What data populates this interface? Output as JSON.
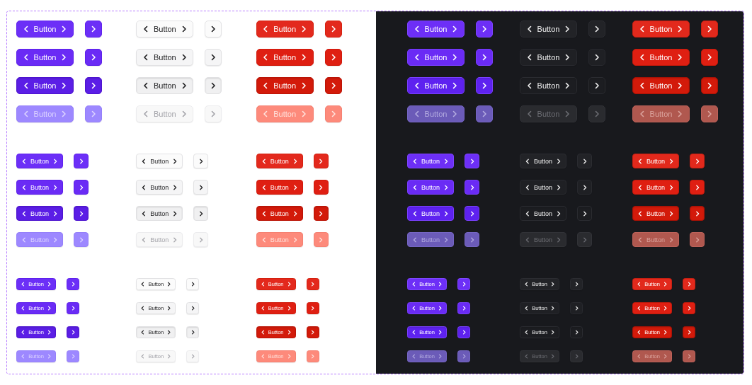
{
  "panels": [
    {
      "kind": "light",
      "groups": [
        {
          "kind": "large",
          "rows": [
            {
              "kind": "default",
              "buttons": [
                {
                  "label": "Button"
                },
                {
                  "label": "Button"
                },
                {
                  "label": "Button"
                }
              ]
            },
            {
              "kind": "hover",
              "buttons": [
                {
                  "label": "Button"
                },
                {
                  "label": "Button"
                },
                {
                  "label": "Button"
                }
              ]
            },
            {
              "kind": "pressed",
              "buttons": [
                {
                  "label": "Button"
                },
                {
                  "label": "Button"
                },
                {
                  "label": "Button"
                }
              ]
            },
            {
              "kind": "disabled",
              "buttons": [
                {
                  "label": "Button"
                },
                {
                  "label": "Button"
                },
                {
                  "label": "Button"
                }
              ]
            }
          ]
        },
        {
          "kind": "medium",
          "rows": [
            {
              "kind": "default",
              "buttons": [
                {
                  "label": "Button"
                },
                {
                  "label": "Button"
                },
                {
                  "label": "Button"
                }
              ]
            },
            {
              "kind": "hover",
              "buttons": [
                {
                  "label": "Button"
                },
                {
                  "label": "Button"
                },
                {
                  "label": "Button"
                }
              ]
            },
            {
              "kind": "pressed",
              "buttons": [
                {
                  "label": "Button"
                },
                {
                  "label": "Button"
                },
                {
                  "label": "Button"
                }
              ]
            },
            {
              "kind": "disabled",
              "buttons": [
                {
                  "label": "Button"
                },
                {
                  "label": "Button"
                },
                {
                  "label": "Button"
                }
              ]
            }
          ]
        },
        {
          "kind": "small",
          "rows": [
            {
              "kind": "default",
              "buttons": [
                {
                  "label": "Button"
                },
                {
                  "label": "Button"
                },
                {
                  "label": "Button"
                }
              ]
            },
            {
              "kind": "hover",
              "buttons": [
                {
                  "label": "Button"
                },
                {
                  "label": "Button"
                },
                {
                  "label": "Button"
                }
              ]
            },
            {
              "kind": "pressed",
              "buttons": [
                {
                  "label": "Button"
                },
                {
                  "label": "Button"
                },
                {
                  "label": "Button"
                }
              ]
            },
            {
              "kind": "disabled",
              "buttons": [
                {
                  "label": "Button"
                },
                {
                  "label": "Button"
                },
                {
                  "label": "Button"
                }
              ]
            }
          ]
        }
      ]
    },
    {
      "kind": "dark",
      "groups": [
        {
          "kind": "large",
          "rows": [
            {
              "kind": "default",
              "buttons": [
                {
                  "label": "Button"
                },
                {
                  "label": "Button"
                },
                {
                  "label": "Button"
                }
              ]
            },
            {
              "kind": "hover",
              "buttons": [
                {
                  "label": "Button"
                },
                {
                  "label": "Button"
                },
                {
                  "label": "Button"
                }
              ]
            },
            {
              "kind": "pressed",
              "buttons": [
                {
                  "label": "Button"
                },
                {
                  "label": "Button"
                },
                {
                  "label": "Button"
                }
              ]
            },
            {
              "kind": "disabled",
              "buttons": [
                {
                  "label": "Button"
                },
                {
                  "label": "Button"
                },
                {
                  "label": "Button"
                }
              ]
            }
          ]
        },
        {
          "kind": "medium",
          "rows": [
            {
              "kind": "default",
              "buttons": [
                {
                  "label": "Button"
                },
                {
                  "label": "Button"
                },
                {
                  "label": "Button"
                }
              ]
            },
            {
              "kind": "hover",
              "buttons": [
                {
                  "label": "Button"
                },
                {
                  "label": "Button"
                },
                {
                  "label": "Button"
                }
              ]
            },
            {
              "kind": "pressed",
              "buttons": [
                {
                  "label": "Button"
                },
                {
                  "label": "Button"
                },
                {
                  "label": "Button"
                }
              ]
            },
            {
              "kind": "disabled",
              "buttons": [
                {
                  "label": "Button"
                },
                {
                  "label": "Button"
                },
                {
                  "label": "Button"
                }
              ]
            }
          ]
        },
        {
          "kind": "small",
          "rows": [
            {
              "kind": "default",
              "buttons": [
                {
                  "label": "Button"
                },
                {
                  "label": "Button"
                },
                {
                  "label": "Button"
                }
              ]
            },
            {
              "kind": "hover",
              "buttons": [
                {
                  "label": "Button"
                },
                {
                  "label": "Button"
                },
                {
                  "label": "Button"
                }
              ]
            },
            {
              "kind": "pressed",
              "buttons": [
                {
                  "label": "Button"
                },
                {
                  "label": "Button"
                },
                {
                  "label": "Button"
                }
              ]
            },
            {
              "kind": "disabled",
              "buttons": [
                {
                  "label": "Button"
                },
                {
                  "label": "Button"
                },
                {
                  "label": "Button"
                }
              ]
            }
          ]
        }
      ]
    }
  ]
}
